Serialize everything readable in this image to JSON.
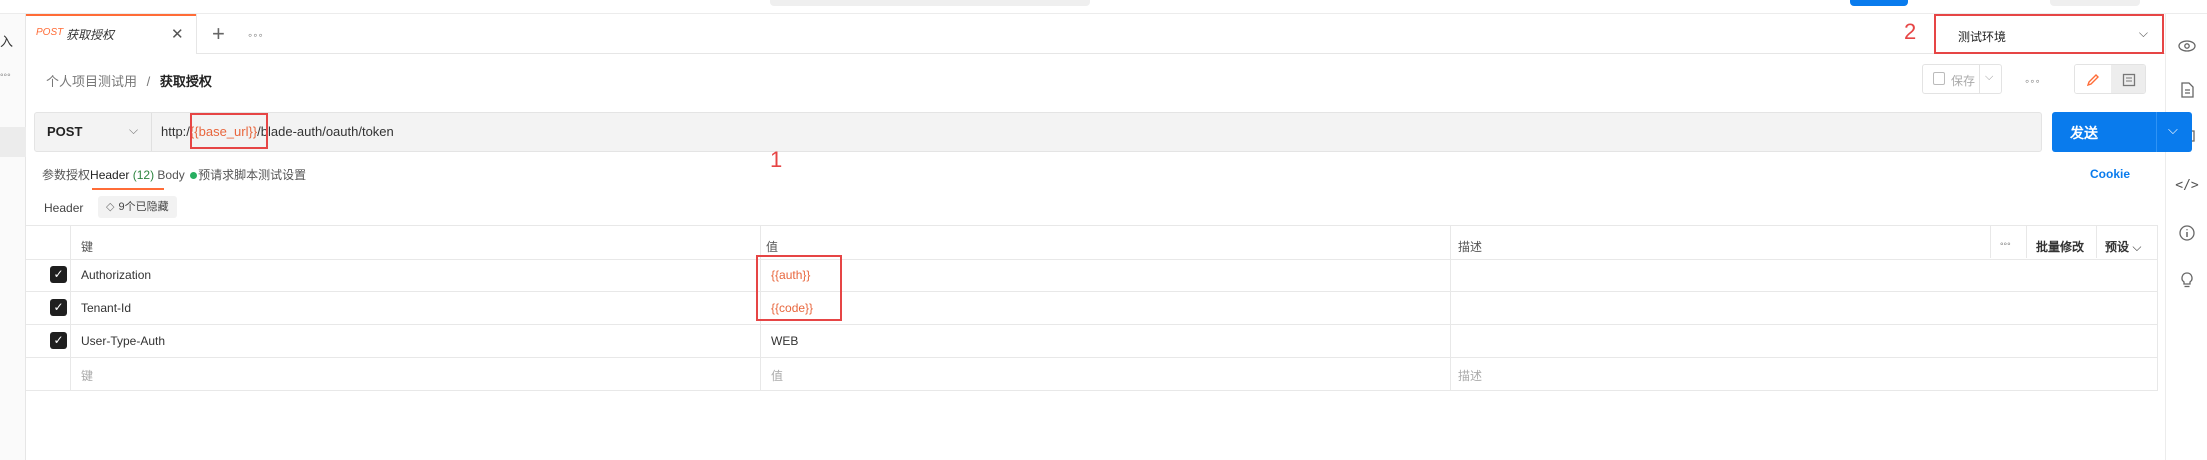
{
  "left_sidebar": {
    "label_top": "入",
    "dots": "◦◦◦"
  },
  "tab": {
    "method": "POST",
    "title": "获取授权"
  },
  "environment": {
    "annotation": "2",
    "name": "测试环境"
  },
  "breadcrumb": {
    "parent": "个人项目测试用",
    "separator": "/",
    "current": "获取授权"
  },
  "toolbar": {
    "save_label": "保存"
  },
  "request": {
    "method": "POST",
    "url_prefix": "http:/",
    "url_variable": "{{base_url}}",
    "url_suffix": "/blade-auth/oauth/token",
    "send_label": "发送",
    "annotation": "1"
  },
  "request_tabs": {
    "params": "参数",
    "auth": "授权",
    "headers": "Header",
    "headers_count": "(12)",
    "body": "Body",
    "prerequest": "预请求脚本",
    "tests": "测试",
    "settings": "设置",
    "cookie": "Cookie"
  },
  "headers_section": {
    "label": "Header",
    "hidden_text": "9个已隐藏"
  },
  "table": {
    "columns": {
      "key": "键",
      "value": "值",
      "description": "描述",
      "bulk_edit": "批量修改",
      "presets": "预设"
    },
    "rows": [
      {
        "key": "Authorization",
        "value": "{{auth}}",
        "checked": true
      },
      {
        "key": "Tenant-Id",
        "value": "{{code}}",
        "checked": true
      },
      {
        "key": "User-Type-Auth",
        "value": "WEB",
        "checked": true
      }
    ],
    "placeholder": {
      "key": "键",
      "value": "值",
      "description": "描述"
    }
  },
  "colors": {
    "accent": "#ff6c37",
    "primary": "#097bed",
    "annotation": "#e64545",
    "variable": "#e8663d"
  }
}
